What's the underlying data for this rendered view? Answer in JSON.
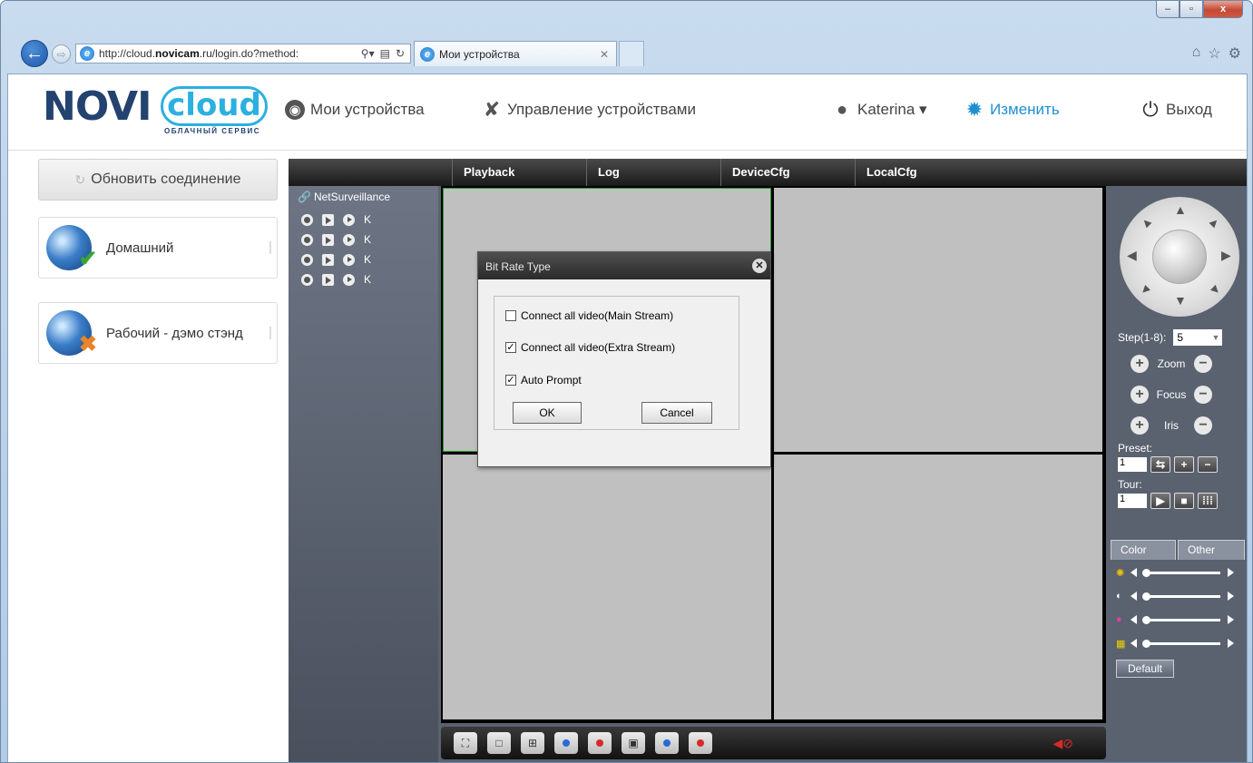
{
  "browser": {
    "url_prefix": "http://cloud.",
    "url_host": "novicam",
    "url_suffix": ".ru/login.do?method:",
    "tab_title": "Мои устройства",
    "window_controls": {
      "minimize": "–",
      "maximize": "▫",
      "close": "x"
    }
  },
  "header": {
    "logo_main": "NOVI",
    "logo_cloud": "cloud",
    "logo_sub": "ОБЛАЧНЫЙ СЕРВИС",
    "nav_devices": "Мои устройства",
    "nav_management": "Управление устройствами",
    "user": "Katerina ▾",
    "edit": "Изменить",
    "logout": "Выход"
  },
  "sidebar": {
    "refresh_label": "Обновить соединение",
    "devices": [
      {
        "name": "Домашний",
        "status": "online"
      },
      {
        "name": "Рабочий - дэмо стэнд",
        "status": "offline"
      }
    ]
  },
  "app": {
    "tabs": [
      "Playback",
      "Log",
      "DeviceCfg",
      "LocalCfg"
    ],
    "tree_root": "NetSurveillance",
    "channel_label": "K",
    "channel_count": 4
  },
  "ptz": {
    "step_label": "Step(1-8):",
    "step_value": "5",
    "zoom": "Zoom",
    "focus": "Focus",
    "iris": "Iris",
    "preset_label": "Preset:",
    "preset_value": "1",
    "tour_label": "Tour:",
    "tour_value": "1",
    "tab_color": "Color",
    "tab_other": "Other",
    "default_label": "Default"
  },
  "dialog": {
    "title": "Bit Rate Type",
    "options": [
      {
        "label": "Connect all video(Main Stream)",
        "checked": false
      },
      {
        "label": "Connect all video(Extra Stream)",
        "checked": true
      },
      {
        "label": "Auto Prompt",
        "checked": true
      }
    ],
    "ok": "OK",
    "cancel": "Cancel"
  }
}
